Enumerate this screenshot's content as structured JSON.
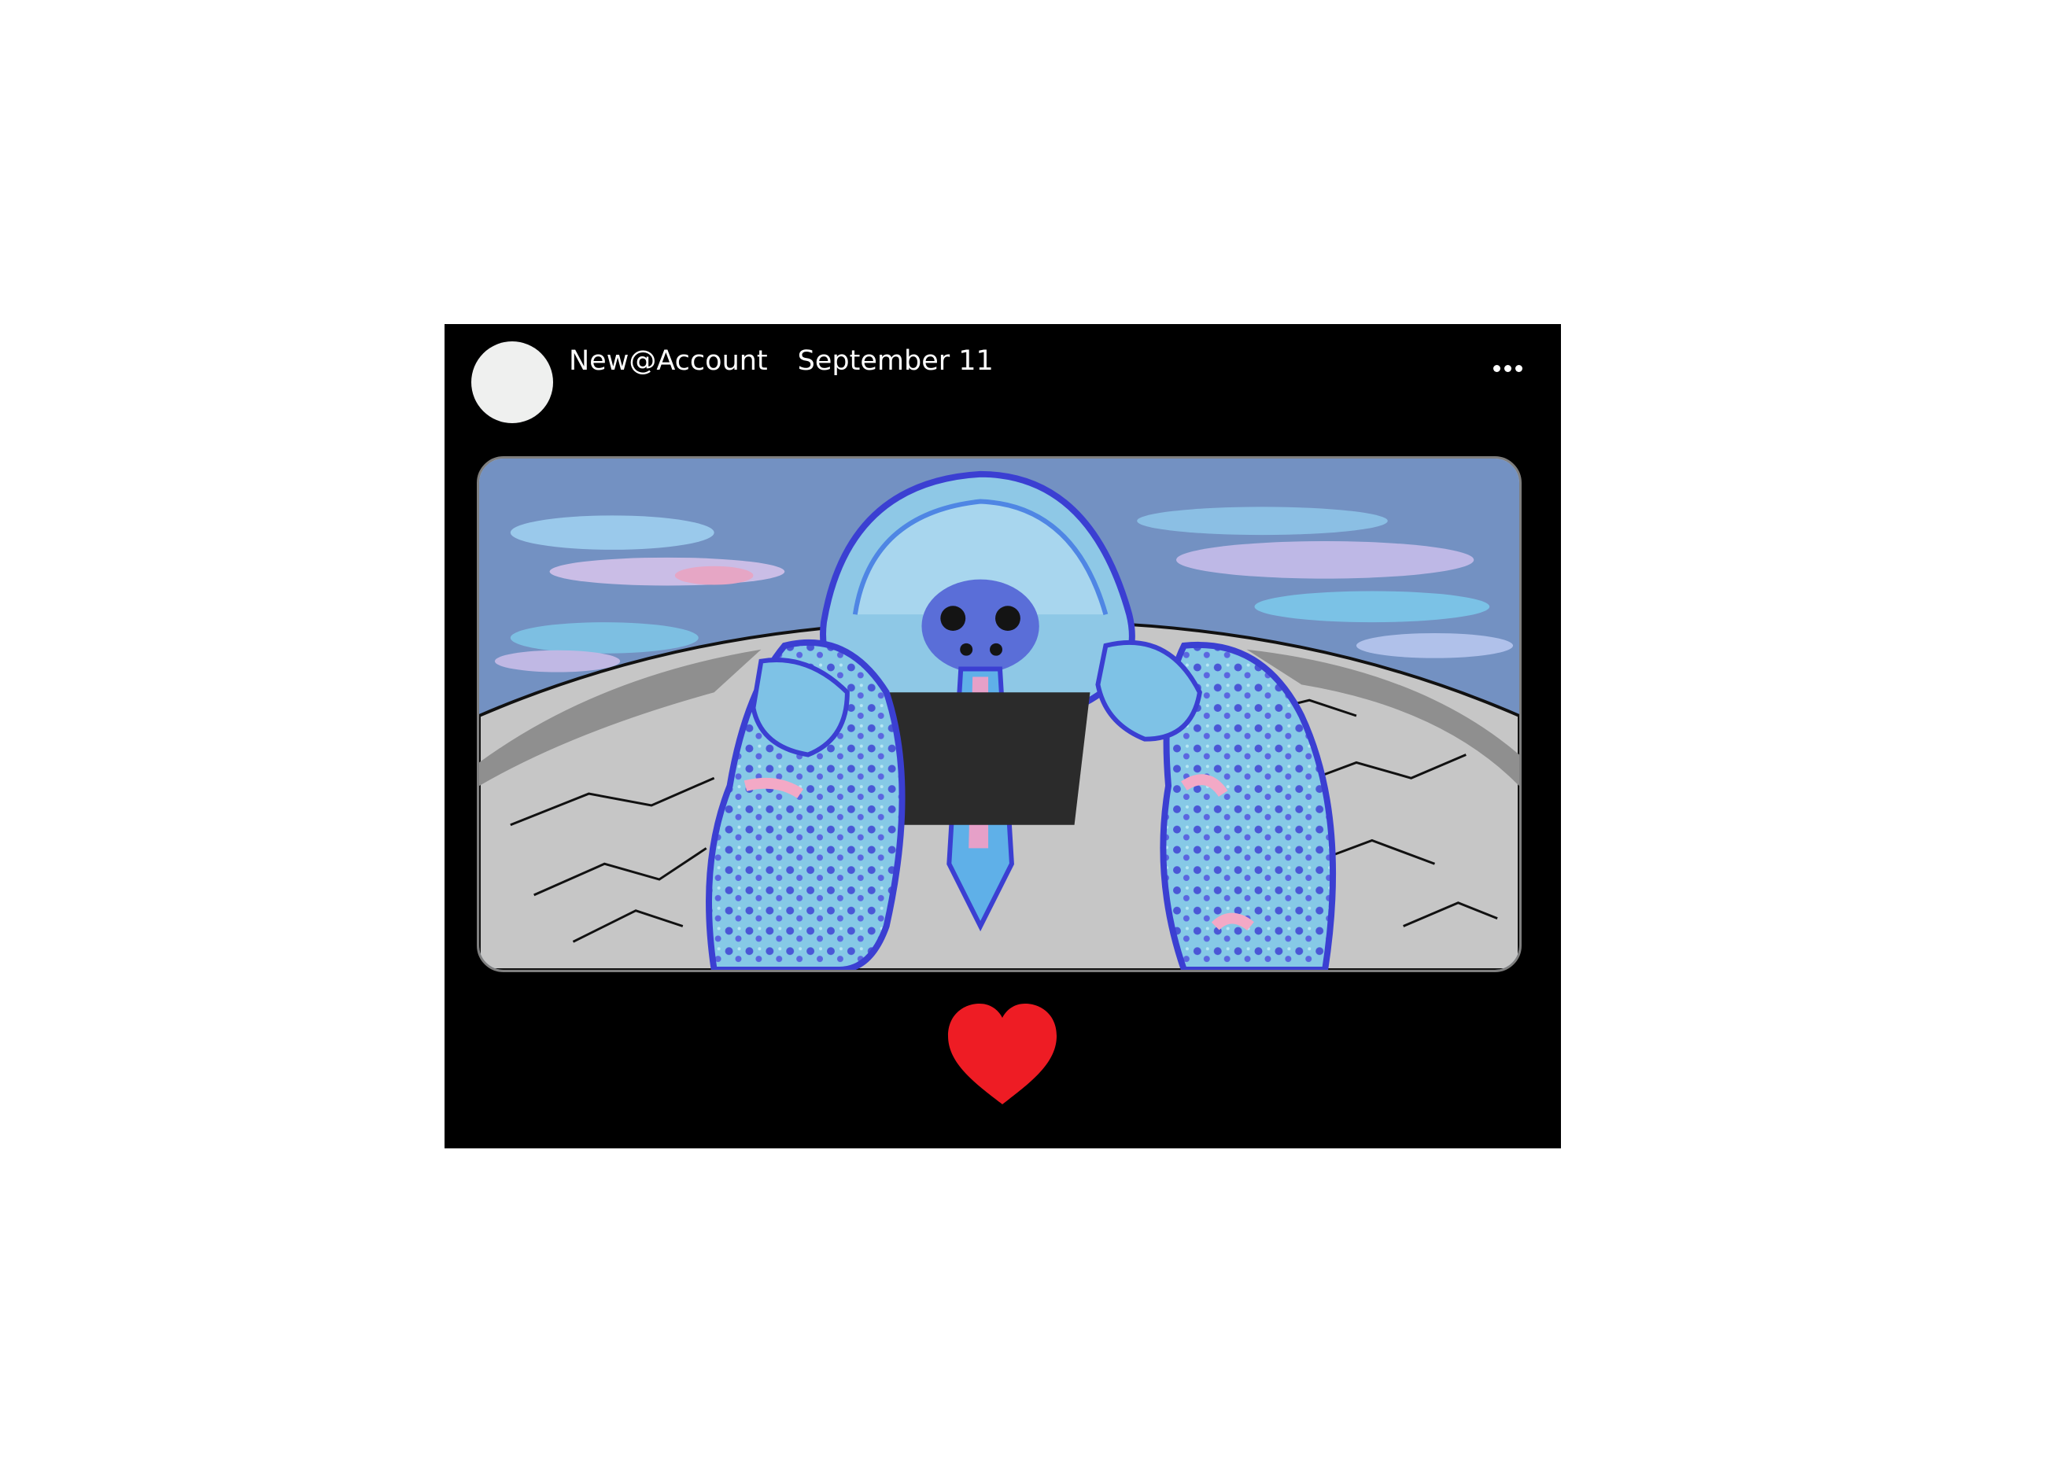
{
  "post": {
    "username": "New@Account",
    "date": "September 11"
  },
  "icons": {
    "avatar": "avatar-placeholder",
    "more": "more-horizontal-icon",
    "like": "heart-icon"
  },
  "colors": {
    "card_background": "#000000",
    "avatar_placeholder": "#eff0ef",
    "heart": "#ee1c24",
    "text": "#ffffff"
  }
}
